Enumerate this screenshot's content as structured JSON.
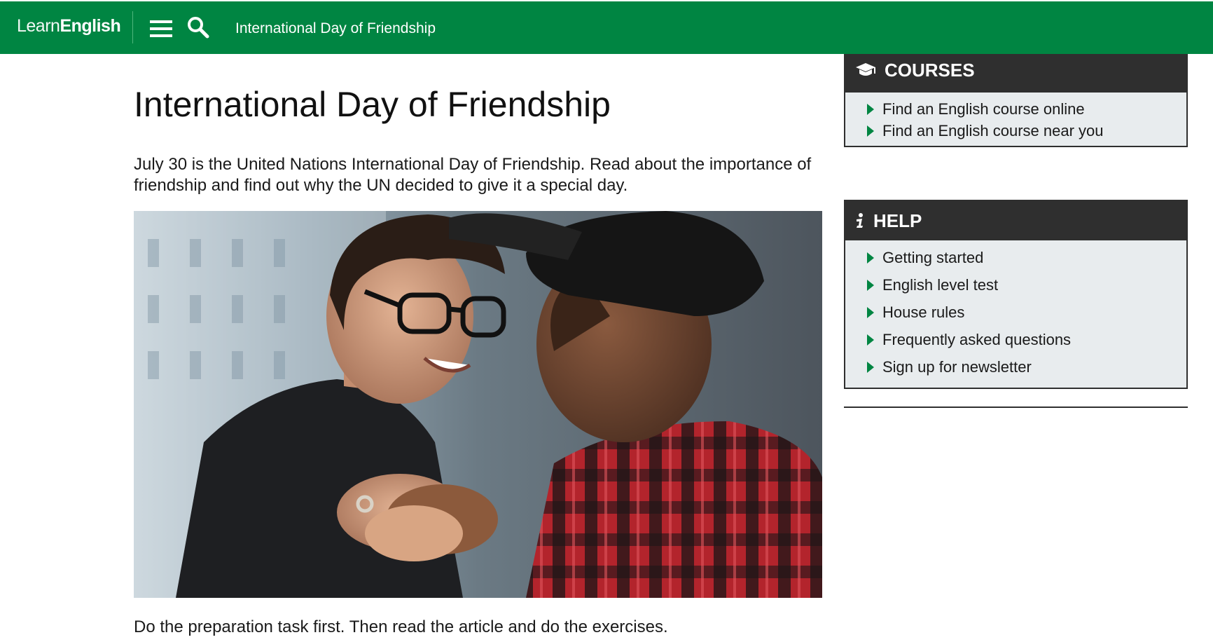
{
  "header": {
    "logo_light": "Learn",
    "logo_bold": "English",
    "breadcrumb": "International Day of Friendship"
  },
  "article": {
    "title": "International Day of Friendship",
    "intro": "July 30 is the United Nations International Day of Friendship. Read about the importance of friendship and find out why the UN decided to give it a special day.",
    "task": "Do the preparation task first. Then read the article and do the exercises."
  },
  "sidebar": {
    "courses": {
      "title": "COURSES",
      "icon": "graduation-cap-icon",
      "items": [
        {
          "label": "Find an English course online"
        },
        {
          "label": "Find an English course near you"
        }
      ]
    },
    "help": {
      "title": "HELP",
      "icon": "info-icon",
      "items": [
        {
          "label": "Getting started"
        },
        {
          "label": "English level test"
        },
        {
          "label": "House rules"
        },
        {
          "label": "Frequently asked questions"
        },
        {
          "label": "Sign up for newsletter"
        }
      ]
    }
  },
  "colors": {
    "brand_green": "#008542",
    "panel_dark": "#2f2f2f",
    "panel_bg": "#e8ecee"
  }
}
